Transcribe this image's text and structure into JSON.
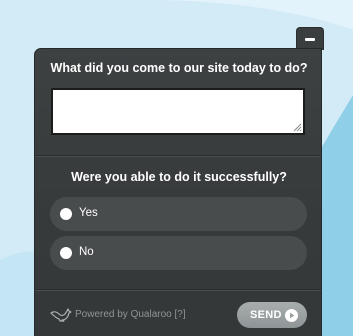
{
  "survey": {
    "question_1": "What did you come to our site today to do?",
    "answer_1_value": "",
    "question_2": "Were you able to do it successfully?",
    "options": [
      {
        "label": "Yes",
        "icon": "radio-unselected"
      },
      {
        "label": "No",
        "icon": "radio-unselected"
      }
    ]
  },
  "footer": {
    "powered_by": "Powered by Qualaroo [?]",
    "logo_icon": "kangaroo-icon",
    "send_label": "SEND",
    "send_icon": "play-circle-icon"
  },
  "controls": {
    "minimize_icon": "minimize-icon"
  },
  "colors": {
    "background": "#d3ebf7",
    "widget": "#3b3e3f",
    "option_pill": "#484c4d",
    "send_button": "#9ba1a2",
    "footer_text": "#8f9596"
  }
}
